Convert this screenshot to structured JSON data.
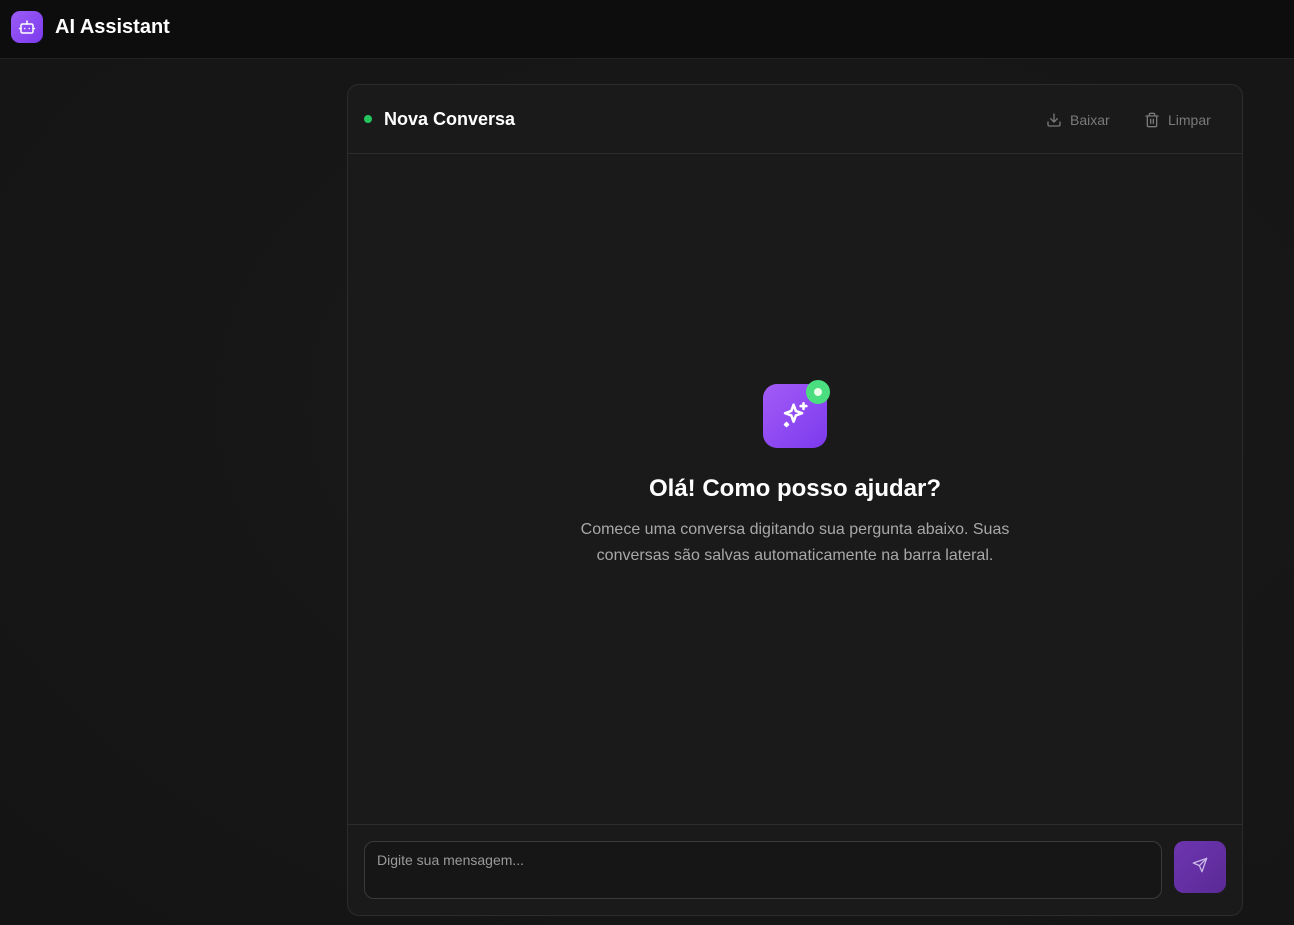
{
  "app": {
    "title": "AI Assistant",
    "brand_icon": "robot-icon",
    "accent_color": "#8b5cf6"
  },
  "conversation": {
    "title": "Nova Conversa",
    "status_color": "#22c55e",
    "actions": {
      "download_label": "Baixar",
      "download_icon": "download-icon",
      "clear_label": "Limpar",
      "clear_icon": "trash-icon"
    }
  },
  "empty_state": {
    "icon": "sparkles-icon",
    "badge_color": "#4ade80",
    "title": "Olá! Como posso ajudar?",
    "description": "Comece uma conversa digitando sua pergunta abaixo. Suas conversas são salvas automaticamente na barra lateral."
  },
  "composer": {
    "placeholder": "Digite sua mensagem...",
    "value": "",
    "send_icon": "send-icon"
  }
}
